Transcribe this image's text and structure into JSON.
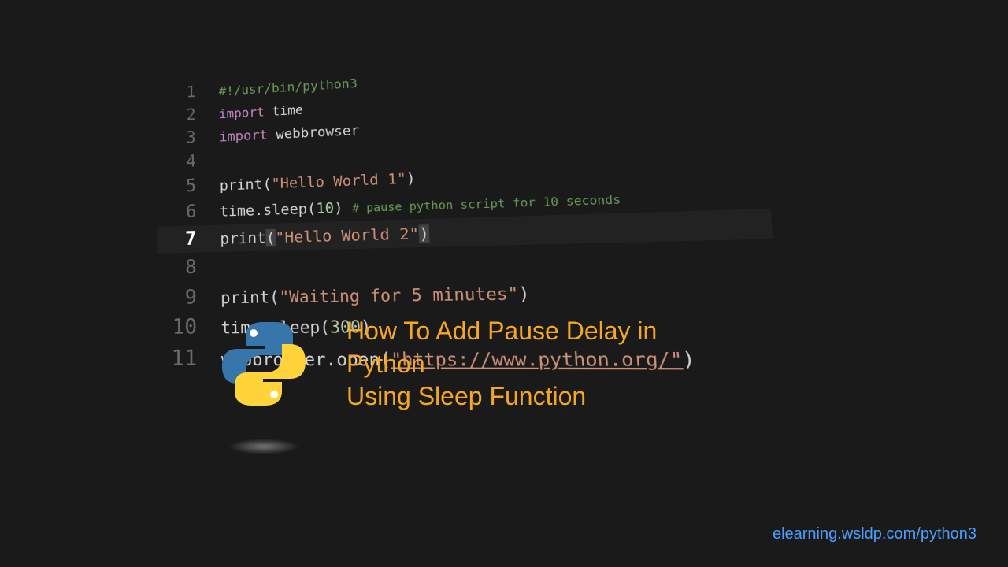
{
  "code": {
    "lines": [
      {
        "num": "1",
        "shebang": "#!/usr/bin/python3"
      },
      {
        "num": "2",
        "import_kw": "import",
        "module": " time"
      },
      {
        "num": "3",
        "import_kw": "import",
        "module": " webbrowser"
      },
      {
        "num": "4",
        "blank": true
      },
      {
        "num": "5",
        "fn": "print",
        "open": "(",
        "str": "\"Hello World 1\"",
        "close": ")"
      },
      {
        "num": "6",
        "fn": "time.sleep",
        "open": "(",
        "num_val": "10",
        "close": ") ",
        "comment": "# pause python script for 10 seconds"
      },
      {
        "num": "7",
        "fn": "print",
        "open_b": "(",
        "str": "\"Hello World 2\"",
        "close_b": ")",
        "cursor": true
      },
      {
        "num": "8",
        "blank": true
      },
      {
        "num": "9",
        "fn": "print",
        "open": "(",
        "str": "\"Waiting for 5 minutes\"",
        "close": ")"
      },
      {
        "num": "10",
        "fn": "time.sleep",
        "open": "(",
        "num_val": "300",
        "close": ")"
      },
      {
        "num": "11",
        "fn": "webbrowser.open",
        "open": "(",
        "url": "\"https://www.python.org/\"",
        "close": ")"
      }
    ]
  },
  "title": {
    "line1": "How To Add Pause Delay in Python",
    "line2": "Using Sleep Function"
  },
  "footer": {
    "url": "elearning.wsldp.com/python3"
  }
}
